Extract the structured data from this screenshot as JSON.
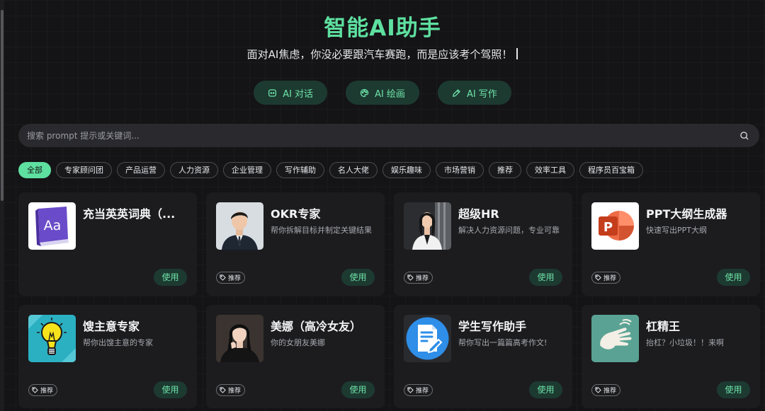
{
  "header": {
    "title": "智能AI助手",
    "subtitle": "面对AI焦虑，你没必要跟汽车赛跑，而是应该考个驾照！"
  },
  "modes": [
    {
      "label": "AI 对话",
      "icon": "chat-icon"
    },
    {
      "label": "AI 绘画",
      "icon": "palette-icon"
    },
    {
      "label": "AI 写作",
      "icon": "pen-icon"
    }
  ],
  "search": {
    "placeholder": "搜索 prompt 提示或关键词...",
    "icon": "search-icon"
  },
  "tags": [
    "全部",
    "专家顾问团",
    "产品运营",
    "人力资源",
    "企业管理",
    "写作辅助",
    "名人大佬",
    "娱乐趣味",
    "市场营销",
    "推荐",
    "效率工具",
    "程序员百宝箱"
  ],
  "active_tag": "全部",
  "card_labels": {
    "use": "使用",
    "badge": "推荐"
  },
  "cards": [
    {
      "name": "充当英英词典（...",
      "desc": "",
      "icon": "dictionary-icon",
      "badge": false
    },
    {
      "name": "OKR专家",
      "desc": "帮你拆解目标并制定关键结果",
      "icon": "businessman-avatar",
      "badge": true
    },
    {
      "name": "超级HR",
      "desc": "解决人力资源问题，专业可靠",
      "icon": "businesswoman-avatar",
      "badge": true
    },
    {
      "name": "PPT大纲生成器",
      "desc": "快速写出PPT大纲",
      "icon": "powerpoint-icon",
      "badge": true
    },
    {
      "name": "馊主意专家",
      "desc": "帮你出馊主意的专家",
      "icon": "lightbulb-icon",
      "badge": true
    },
    {
      "name": "美娜（高冷女友）",
      "desc": "你的女朋友美娜",
      "icon": "girl-avatar",
      "badge": true
    },
    {
      "name": "学生写作助手",
      "desc": "帮你写出一篇篇高考作文!",
      "icon": "document-edit-icon",
      "badge": true
    },
    {
      "name": "杠精王",
      "desc": "抬杠？小垃圾！！来啊",
      "icon": "hand-wave-icon",
      "badge": true
    }
  ],
  "colors": {
    "accent": "#5ee0a0",
    "button_bg": "#1d3a31",
    "card_bg": "#1c1c1f",
    "page_bg": "#141416"
  }
}
